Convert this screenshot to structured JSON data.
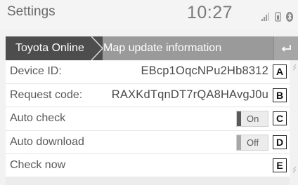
{
  "header": {
    "title": "Settings",
    "time": "10:27"
  },
  "breadcrumb": {
    "first": "Toyota Online",
    "second": "Map update information"
  },
  "rows": [
    {
      "label": "Device ID:",
      "value": "EBcp1OqcNPu2Hb8312",
      "marker": "A"
    },
    {
      "label": "Request code:",
      "value": "RAXKdTqnDT7rQA8HAvgJ0u",
      "marker": "B"
    },
    {
      "label": "Auto check",
      "toggle": "On",
      "marker": "C"
    },
    {
      "label": "Auto download",
      "toggle": "Off",
      "marker": "D"
    },
    {
      "label": "Check now",
      "marker": "E"
    }
  ],
  "icons": {
    "back": "back-arrow-icon",
    "signal": "signal-icon",
    "phone": "phone-battery-icon",
    "bluetooth": "bluetooth-icon"
  }
}
